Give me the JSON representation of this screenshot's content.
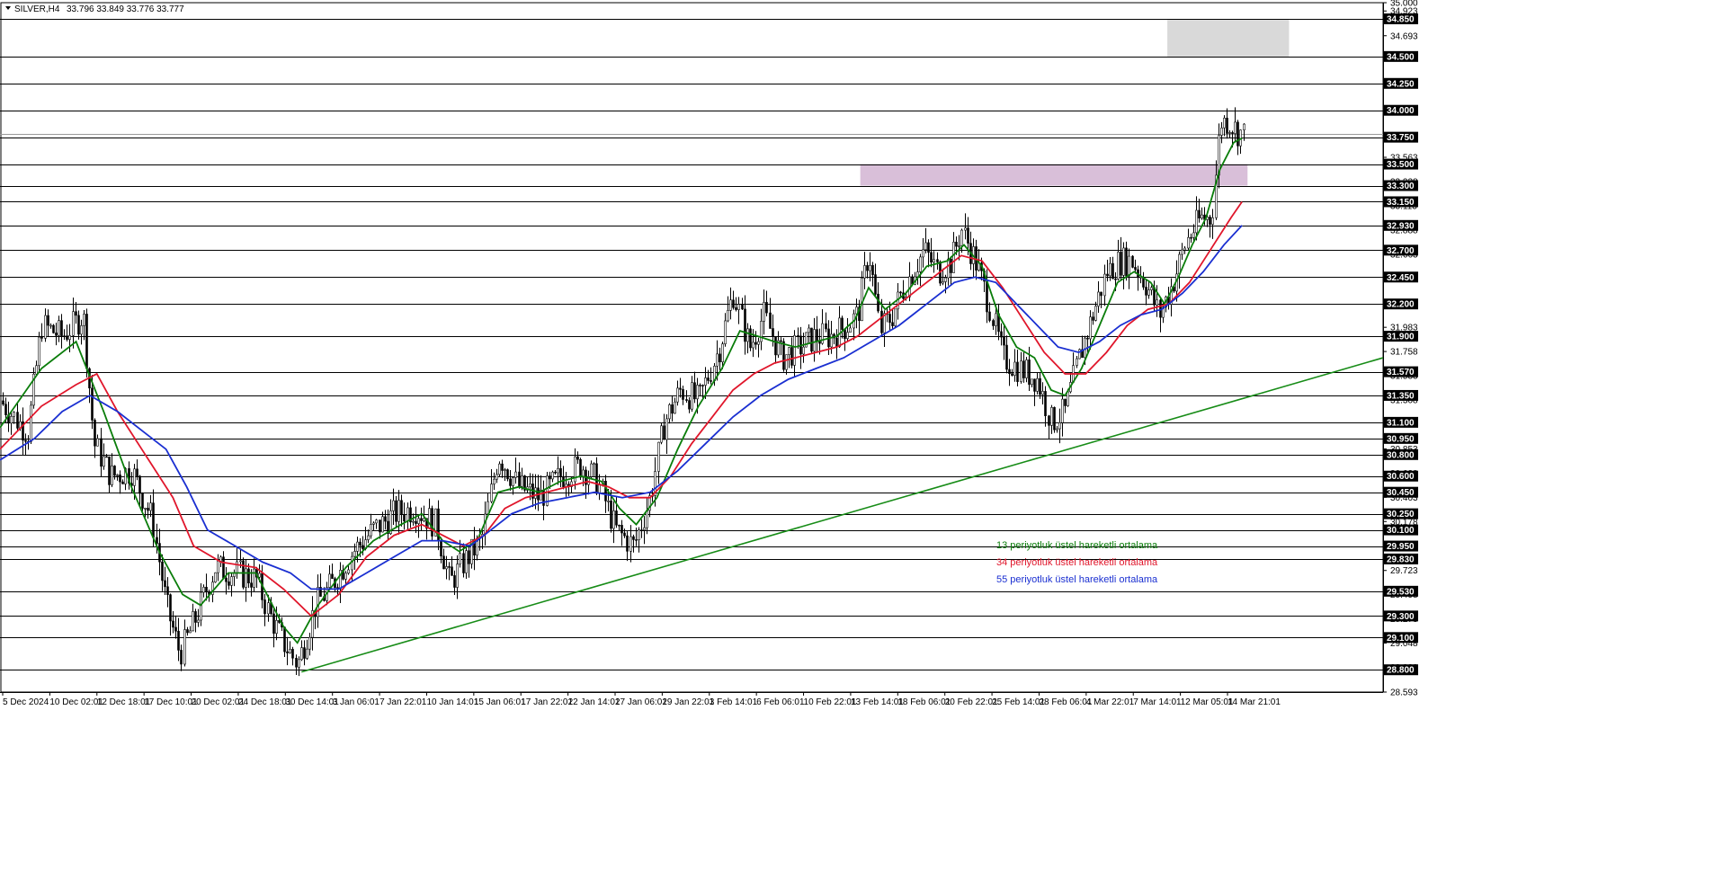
{
  "header": {
    "symbol": "SILVER,H4",
    "ohlc": "33.796 33.849 33.776 33.777"
  },
  "colors": {
    "ema13": "#0a7d0a",
    "ema34": "#e0162b",
    "ema55": "#1a2fd1",
    "trendline": "#178c17",
    "candle": "#000000",
    "grid": "#000000",
    "zone_resistance": "#d9d9d9",
    "zone_breakout": "#d9bfd9"
  },
  "legend": [
    {
      "label": "13 periyotluk üstel hareketli ortalama",
      "color": "#0a7d0a"
    },
    {
      "label": "34 periyotluk üstel hareketli ortalama",
      "color": "#e0162b"
    },
    {
      "label": "55 periyotluk üstel hareketli ortalama",
      "color": "#1a2fd1"
    }
  ],
  "chart_data": {
    "type": "line",
    "symbol": "SILVER",
    "timeframe": "H4",
    "ylim": [
      28.593,
      35.0
    ],
    "y_ticks": [
      "35.000",
      "34.923",
      "34.693",
      "34.238",
      "33.563",
      "33.338",
      "33.113",
      "32.888",
      "32.663",
      "32.438",
      "32.213",
      "31.983",
      "31.758",
      "31.533",
      "31.308",
      "31.083",
      "30.853",
      "30.628",
      "30.403",
      "30.178",
      "29.953",
      "29.723",
      "29.498",
      "29.273",
      "29.048",
      "28.823",
      "28.593"
    ],
    "x_ticks": [
      "5 Dec 2024",
      "10 Dec 02:01",
      "12 Dec 18:01",
      "17 Dec 10:01",
      "20 Dec 02:01",
      "24 Dec 18:01",
      "30 Dec 14:01",
      "3 Jan 06:01",
      "7 Jan 22:01",
      "10 Jan 14:01",
      "15 Jan 06:01",
      "17 Jan 22:01",
      "22 Jan 14:01",
      "27 Jan 06:01",
      "29 Jan 22:01",
      "3 Feb 14:01",
      "6 Feb 06:01",
      "10 Feb 22:01",
      "13 Feb 14:01",
      "18 Feb 06:01",
      "20 Feb 22:01",
      "25 Feb 14:01",
      "28 Feb 06:01",
      "4 Mar 22:01",
      "7 Mar 14:01",
      "12 Mar 05:01",
      "14 Mar 21:01"
    ],
    "levels": [
      "34.850",
      "34.500",
      "34.250",
      "34.000",
      "33.750",
      "33.500",
      "33.300",
      "33.150",
      "32.930",
      "32.700",
      "32.450",
      "32.200",
      "31.900",
      "31.570",
      "31.350",
      "31.100",
      "30.950",
      "30.800",
      "30.600",
      "30.450",
      "30.250",
      "30.100",
      "29.950",
      "29.830",
      "29.530",
      "29.300",
      "29.100",
      "28.800"
    ],
    "current_price": 33.777,
    "zones": [
      {
        "name": "resistance",
        "from": 34.5,
        "to": 34.85,
        "x_from": 0.844,
        "x_to": 0.932
      },
      {
        "name": "breakout",
        "from": 33.3,
        "to": 33.5,
        "x_from": 0.622,
        "x_to": 0.902
      }
    ],
    "trendline": {
      "points": [
        [
          0.218,
          28.78
        ],
        [
          1.0,
          31.7
        ]
      ]
    },
    "series": [
      {
        "key": "close",
        "points": [
          [
            0.0,
            31.3
          ],
          [
            0.02,
            31.0
          ],
          [
            0.03,
            32.0
          ],
          [
            0.045,
            31.9
          ],
          [
            0.06,
            32.1
          ],
          [
            0.068,
            30.9
          ],
          [
            0.08,
            30.6
          ],
          [
            0.095,
            30.65
          ],
          [
            0.11,
            30.2
          ],
          [
            0.12,
            29.4
          ],
          [
            0.13,
            28.95
          ],
          [
            0.142,
            29.3
          ],
          [
            0.155,
            29.75
          ],
          [
            0.17,
            29.7
          ],
          [
            0.185,
            29.65
          ],
          [
            0.195,
            29.3
          ],
          [
            0.205,
            29.05
          ],
          [
            0.215,
            28.85
          ],
          [
            0.228,
            29.4
          ],
          [
            0.24,
            29.6
          ],
          [
            0.255,
            29.9
          ],
          [
            0.27,
            30.1
          ],
          [
            0.285,
            30.25
          ],
          [
            0.3,
            30.3
          ],
          [
            0.315,
            30.15
          ],
          [
            0.325,
            29.6
          ],
          [
            0.335,
            29.8
          ],
          [
            0.348,
            30.0
          ],
          [
            0.36,
            30.8
          ],
          [
            0.375,
            30.5
          ],
          [
            0.39,
            30.4
          ],
          [
            0.405,
            30.6
          ],
          [
            0.42,
            30.7
          ],
          [
            0.432,
            30.55
          ],
          [
            0.445,
            30.1
          ],
          [
            0.458,
            29.95
          ],
          [
            0.47,
            30.4
          ],
          [
            0.48,
            31.1
          ],
          [
            0.492,
            31.4
          ],
          [
            0.505,
            31.3
          ],
          [
            0.52,
            31.8
          ],
          [
            0.53,
            32.3
          ],
          [
            0.542,
            31.8
          ],
          [
            0.552,
            32.1
          ],
          [
            0.565,
            31.7
          ],
          [
            0.578,
            31.8
          ],
          [
            0.59,
            31.9
          ],
          [
            0.6,
            31.9
          ],
          [
            0.612,
            32.0
          ],
          [
            0.62,
            32.1
          ],
          [
            0.628,
            32.7
          ],
          [
            0.636,
            31.95
          ],
          [
            0.645,
            32.1
          ],
          [
            0.655,
            32.4
          ],
          [
            0.668,
            32.7
          ],
          [
            0.678,
            32.5
          ],
          [
            0.688,
            32.6
          ],
          [
            0.695,
            32.9
          ],
          [
            0.705,
            32.6
          ],
          [
            0.715,
            32.2
          ],
          [
            0.725,
            31.7
          ],
          [
            0.737,
            31.6
          ],
          [
            0.75,
            31.5
          ],
          [
            0.76,
            31.1
          ],
          [
            0.77,
            31.2
          ],
          [
            0.78,
            31.7
          ],
          [
            0.79,
            32.1
          ],
          [
            0.8,
            32.5
          ],
          [
            0.81,
            32.6
          ],
          [
            0.818,
            32.6
          ],
          [
            0.828,
            32.4
          ],
          [
            0.838,
            32.1
          ],
          [
            0.848,
            32.4
          ],
          [
            0.858,
            32.8
          ],
          [
            0.868,
            33.0
          ],
          [
            0.876,
            33.0
          ],
          [
            0.882,
            33.9
          ],
          [
            0.888,
            33.9
          ],
          [
            0.895,
            33.8
          ],
          [
            0.9,
            33.78
          ]
        ]
      },
      {
        "key": "ema13",
        "name": "13 periyotluk üstel hareketli ortalama",
        "color": "#0a7d0a",
        "points": [
          [
            0.0,
            31.05
          ],
          [
            0.03,
            31.6
          ],
          [
            0.055,
            31.85
          ],
          [
            0.075,
            31.2
          ],
          [
            0.095,
            30.5
          ],
          [
            0.115,
            29.9
          ],
          [
            0.132,
            29.5
          ],
          [
            0.145,
            29.4
          ],
          [
            0.165,
            29.7
          ],
          [
            0.185,
            29.7
          ],
          [
            0.205,
            29.2
          ],
          [
            0.215,
            29.05
          ],
          [
            0.23,
            29.4
          ],
          [
            0.25,
            29.75
          ],
          [
            0.27,
            30.0
          ],
          [
            0.29,
            30.15
          ],
          [
            0.305,
            30.25
          ],
          [
            0.32,
            30.0
          ],
          [
            0.332,
            29.9
          ],
          [
            0.345,
            30.0
          ],
          [
            0.36,
            30.45
          ],
          [
            0.375,
            30.5
          ],
          [
            0.39,
            30.45
          ],
          [
            0.405,
            30.55
          ],
          [
            0.42,
            30.6
          ],
          [
            0.435,
            30.55
          ],
          [
            0.448,
            30.3
          ],
          [
            0.46,
            30.15
          ],
          [
            0.475,
            30.4
          ],
          [
            0.49,
            30.85
          ],
          [
            0.505,
            31.25
          ],
          [
            0.522,
            31.6
          ],
          [
            0.535,
            31.95
          ],
          [
            0.548,
            31.9
          ],
          [
            0.56,
            31.85
          ],
          [
            0.575,
            31.8
          ],
          [
            0.59,
            31.85
          ],
          [
            0.605,
            31.9
          ],
          [
            0.618,
            32.05
          ],
          [
            0.628,
            32.35
          ],
          [
            0.64,
            32.15
          ],
          [
            0.655,
            32.3
          ],
          [
            0.67,
            32.55
          ],
          [
            0.685,
            32.6
          ],
          [
            0.697,
            32.75
          ],
          [
            0.71,
            32.55
          ],
          [
            0.722,
            32.1
          ],
          [
            0.735,
            31.8
          ],
          [
            0.748,
            31.7
          ],
          [
            0.76,
            31.4
          ],
          [
            0.77,
            31.35
          ],
          [
            0.782,
            31.6
          ],
          [
            0.795,
            32.0
          ],
          [
            0.808,
            32.4
          ],
          [
            0.82,
            32.5
          ],
          [
            0.832,
            32.4
          ],
          [
            0.842,
            32.2
          ],
          [
            0.852,
            32.45
          ],
          [
            0.862,
            32.75
          ],
          [
            0.872,
            33.0
          ],
          [
            0.882,
            33.45
          ],
          [
            0.892,
            33.7
          ],
          [
            0.898,
            33.74
          ]
        ]
      },
      {
        "key": "ema34",
        "name": "34 periyotluk üstel hareketli ortalama",
        "color": "#e0162b",
        "points": [
          [
            0.0,
            30.85
          ],
          [
            0.03,
            31.25
          ],
          [
            0.055,
            31.45
          ],
          [
            0.07,
            31.55
          ],
          [
            0.085,
            31.2
          ],
          [
            0.105,
            30.8
          ],
          [
            0.125,
            30.4
          ],
          [
            0.14,
            29.95
          ],
          [
            0.16,
            29.8
          ],
          [
            0.185,
            29.75
          ],
          [
            0.205,
            29.55
          ],
          [
            0.225,
            29.3
          ],
          [
            0.245,
            29.5
          ],
          [
            0.265,
            29.85
          ],
          [
            0.285,
            30.05
          ],
          [
            0.305,
            30.15
          ],
          [
            0.32,
            30.05
          ],
          [
            0.335,
            29.95
          ],
          [
            0.35,
            30.05
          ],
          [
            0.365,
            30.3
          ],
          [
            0.38,
            30.4
          ],
          [
            0.395,
            30.45
          ],
          [
            0.41,
            30.5
          ],
          [
            0.425,
            30.55
          ],
          [
            0.44,
            30.5
          ],
          [
            0.455,
            30.4
          ],
          [
            0.47,
            30.4
          ],
          [
            0.485,
            30.6
          ],
          [
            0.5,
            30.9
          ],
          [
            0.515,
            31.15
          ],
          [
            0.53,
            31.4
          ],
          [
            0.545,
            31.55
          ],
          [
            0.56,
            31.65
          ],
          [
            0.575,
            31.7
          ],
          [
            0.59,
            31.75
          ],
          [
            0.605,
            31.8
          ],
          [
            0.62,
            31.9
          ],
          [
            0.635,
            32.05
          ],
          [
            0.65,
            32.2
          ],
          [
            0.665,
            32.35
          ],
          [
            0.68,
            32.5
          ],
          [
            0.695,
            32.65
          ],
          [
            0.71,
            32.6
          ],
          [
            0.725,
            32.35
          ],
          [
            0.74,
            32.05
          ],
          [
            0.755,
            31.75
          ],
          [
            0.77,
            31.55
          ],
          [
            0.785,
            31.55
          ],
          [
            0.8,
            31.75
          ],
          [
            0.815,
            32.0
          ],
          [
            0.83,
            32.15
          ],
          [
            0.845,
            32.2
          ],
          [
            0.86,
            32.4
          ],
          [
            0.875,
            32.7
          ],
          [
            0.89,
            33.0
          ],
          [
            0.898,
            33.15
          ]
        ]
      },
      {
        "key": "ema55",
        "name": "55 periyotluk üstel hareketli ortalama",
        "color": "#1a2fd1",
        "points": [
          [
            0.0,
            30.75
          ],
          [
            0.025,
            30.95
          ],
          [
            0.045,
            31.2
          ],
          [
            0.065,
            31.35
          ],
          [
            0.085,
            31.2
          ],
          [
            0.105,
            31.0
          ],
          [
            0.12,
            30.85
          ],
          [
            0.135,
            30.5
          ],
          [
            0.15,
            30.1
          ],
          [
            0.17,
            29.95
          ],
          [
            0.19,
            29.8
          ],
          [
            0.21,
            29.7
          ],
          [
            0.225,
            29.55
          ],
          [
            0.245,
            29.55
          ],
          [
            0.265,
            29.7
          ],
          [
            0.285,
            29.85
          ],
          [
            0.305,
            30.0
          ],
          [
            0.32,
            30.0
          ],
          [
            0.34,
            29.95
          ],
          [
            0.355,
            30.1
          ],
          [
            0.37,
            30.25
          ],
          [
            0.39,
            30.35
          ],
          [
            0.41,
            30.4
          ],
          [
            0.43,
            30.45
          ],
          [
            0.45,
            30.4
          ],
          [
            0.47,
            30.45
          ],
          [
            0.49,
            30.65
          ],
          [
            0.51,
            30.9
          ],
          [
            0.53,
            31.15
          ],
          [
            0.55,
            31.35
          ],
          [
            0.57,
            31.5
          ],
          [
            0.59,
            31.6
          ],
          [
            0.61,
            31.7
          ],
          [
            0.63,
            31.85
          ],
          [
            0.65,
            32.0
          ],
          [
            0.67,
            32.2
          ],
          [
            0.69,
            32.4
          ],
          [
            0.705,
            32.45
          ],
          [
            0.72,
            32.4
          ],
          [
            0.735,
            32.2
          ],
          [
            0.75,
            32.0
          ],
          [
            0.765,
            31.8
          ],
          [
            0.78,
            31.75
          ],
          [
            0.795,
            31.85
          ],
          [
            0.81,
            32.0
          ],
          [
            0.825,
            32.1
          ],
          [
            0.84,
            32.15
          ],
          [
            0.855,
            32.3
          ],
          [
            0.87,
            32.5
          ],
          [
            0.885,
            32.75
          ],
          [
            0.898,
            32.93
          ]
        ]
      }
    ]
  }
}
